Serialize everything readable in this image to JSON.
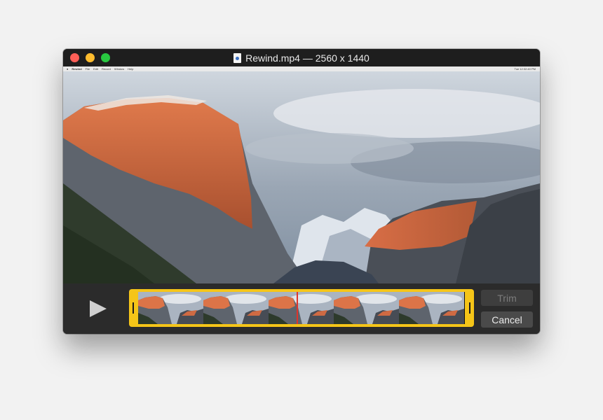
{
  "window": {
    "title": "Rewind.mp4 — 2560 x 1440"
  },
  "video": {
    "menubar": {
      "app": "Rewind",
      "items": [
        "File",
        "Edit",
        "Record",
        "Window",
        "Help"
      ],
      "clock": "Tue 12:32:40 PM"
    }
  },
  "controls": {
    "trim_label": "Trim",
    "cancel_label": "Cancel",
    "frame_count": 10,
    "playhead_position": 0.51
  },
  "colors": {
    "timeline_border": "#f5c518",
    "playhead": "#e0342b",
    "close": "#fe5f57",
    "minimize": "#febc2e",
    "maximize": "#28c840"
  },
  "icons": {
    "play": "play-icon",
    "document": "document-icon"
  }
}
